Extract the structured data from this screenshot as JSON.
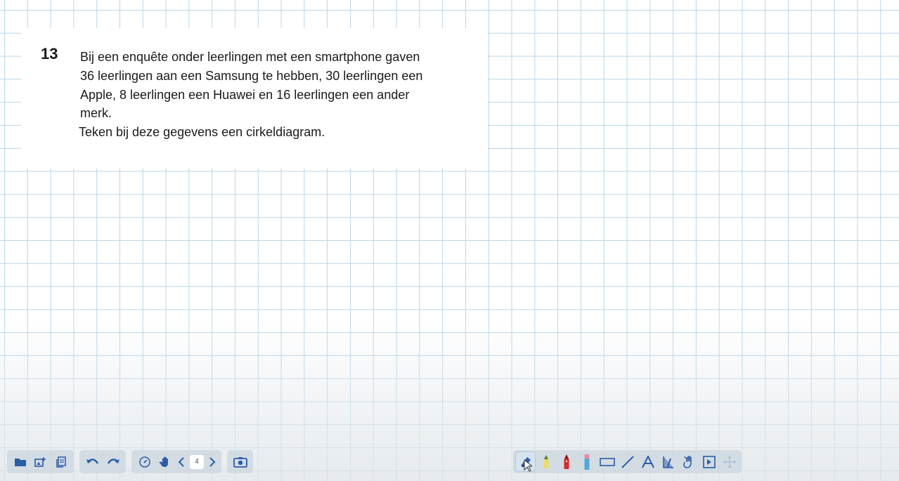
{
  "question": {
    "number": "13",
    "lines": [
      "Bij een enquête onder leerlingen met een smartphone gaven",
      "36 leerlingen aan een Samsung te hebben, 30 leerlingen een",
      "Apple, 8 leerlingen een Huawei en 16 leerlingen een ander",
      "merk.",
      "Teken bij deze gegevens een cirkeldiagram."
    ]
  },
  "toolbar_left": {
    "icons": [
      "folder-icon",
      "insert-image-icon",
      "page-overview-icon",
      "undo-icon",
      "redo-icon",
      "timer-icon",
      "hand-pan-icon",
      "prev-page-icon",
      "next-page-icon",
      "screenshot-camera-icon"
    ],
    "page_number": "4"
  },
  "toolbar_right": {
    "icons": [
      "pen-tool-icon",
      "highlighter-icon",
      "marker-icon",
      "eraser-icon",
      "rectangle-icon",
      "line-icon",
      "text-icon",
      "protractor-icon",
      "pointer-hand-icon",
      "presentation-icon",
      "move-icon"
    ],
    "active_tool": "pen-tool-icon"
  },
  "colors": {
    "grid_line": "#b9d6e8",
    "icon": "#2b5da6",
    "highlighter": "#e8dc6a",
    "marker": "#d32a2a",
    "eraser": "#4fa8d8"
  }
}
